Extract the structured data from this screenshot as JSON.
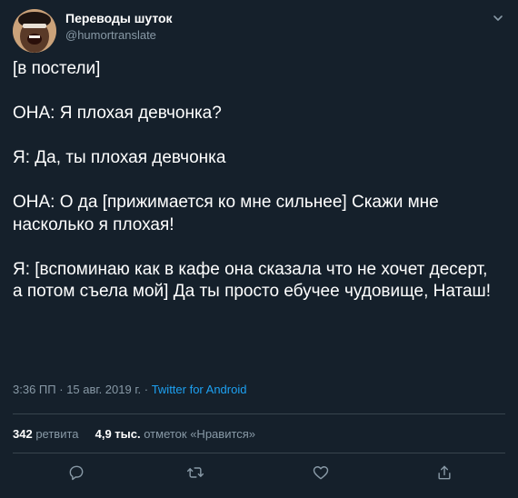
{
  "author": {
    "name": "Переводы шуток",
    "handle": "@humortranslate"
  },
  "tweet": {
    "lines": [
      "[в постели]",
      "",
      "ОНА: Я плохая девчонка?",
      "",
      "Я: Да, ты плохая девчонка",
      "",
      "ОНА: О да [прижимается ко мне сильнее] Скажи мне насколько я плохая!",
      "",
      "Я: [вспоминаю как в кафе она сказала что не хочет десерт, а потом съела мой] Да ты просто ебучее чудовище, Наташ!"
    ],
    "time": "3:36 ПП",
    "date": "15 авг. 2019 г.",
    "separator": "·",
    "source": "Twitter for Android"
  },
  "stats": {
    "retweets_count": "342",
    "retweets_label": "ретвита",
    "likes_count": "4,9 тыс.",
    "likes_label": "отметок «Нравится»"
  },
  "icons": {
    "reply": "reply-icon",
    "retweet": "retweet-icon",
    "like": "heart-icon",
    "share": "share-icon",
    "caret": "chevron-down-icon"
  },
  "colors": {
    "background": "#15202b",
    "text": "#ffffff",
    "secondary": "#8899a6",
    "accent": "#1da1f2"
  }
}
